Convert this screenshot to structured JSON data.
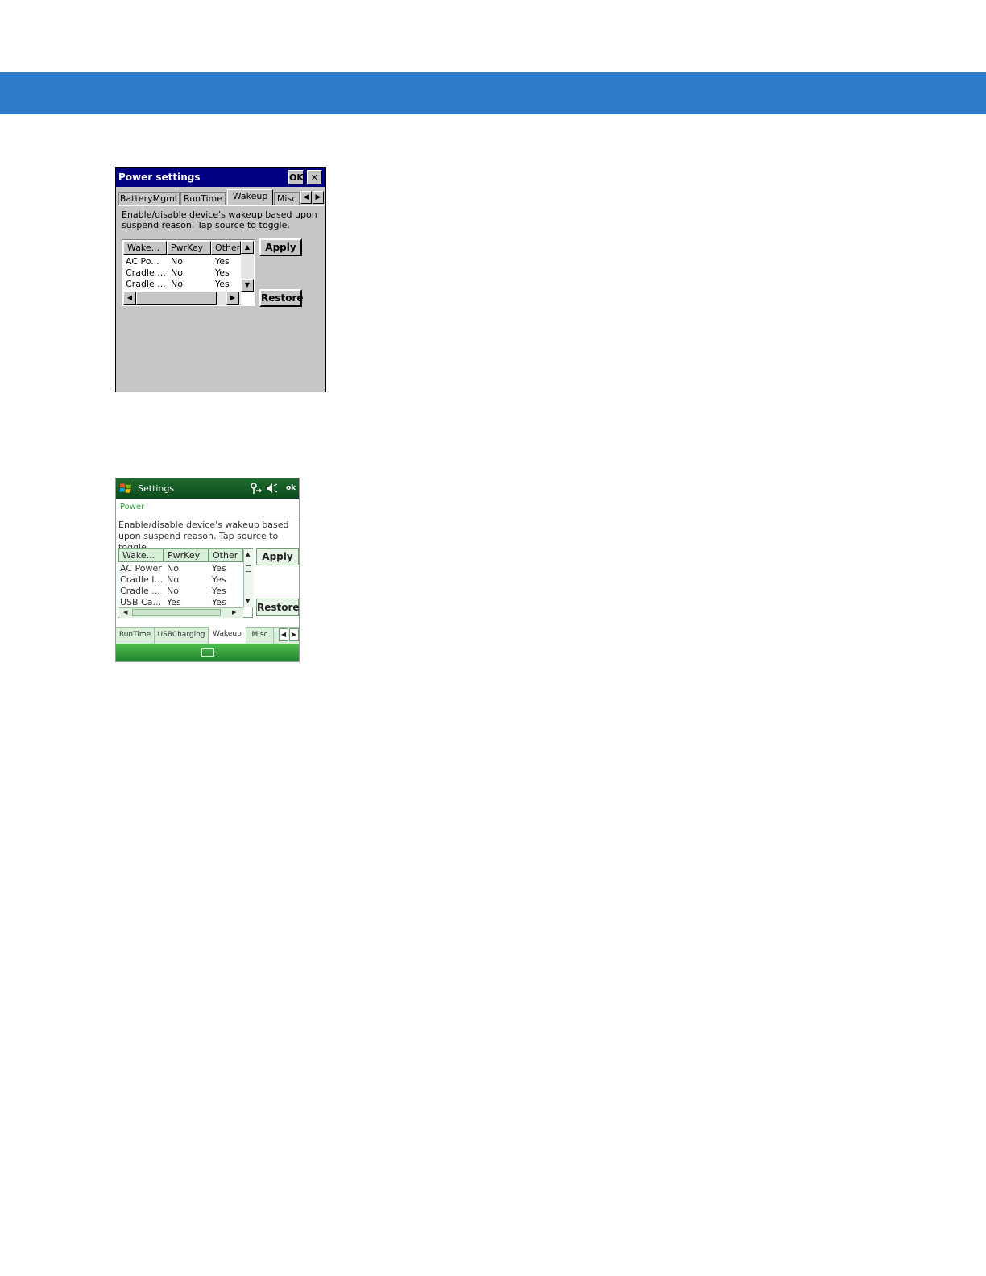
{
  "ce": {
    "title": "Power settings",
    "ok_label": "OK",
    "close_glyph": "✕",
    "tabs": [
      "BatteryMgmt",
      "RunTime",
      "Wakeup",
      "Misc"
    ],
    "active_tab": "Wakeup",
    "tab_arrow_left": "◀",
    "tab_arrow_right": "▶",
    "description": "Enable/disable device's wakeup based upon suspend reason. Tap source to toggle.",
    "columns": [
      "Wake...",
      "PwrKey",
      "Other"
    ],
    "rows": [
      [
        "AC Po...",
        "No",
        "Yes"
      ],
      [
        "Cradle ...",
        "No",
        "Yes"
      ],
      [
        "Cradle ...",
        "No",
        "Yes"
      ]
    ],
    "scroll_up": "▲",
    "scroll_down": "▼",
    "scroll_left": "◀",
    "scroll_right": "▶",
    "apply_label": "Apply",
    "restore_label": "Restore"
  },
  "wm": {
    "title": "Settings",
    "ok_label": "ok",
    "section": "Power",
    "description": "Enable/disable device's wakeup based upon suspend reason. Tap source to toggle.",
    "columns": [
      "Wake...",
      "PwrKey",
      "Other"
    ],
    "rows": [
      [
        "AC Power",
        "No",
        "Yes"
      ],
      [
        "Cradle I...",
        "No",
        "Yes"
      ],
      [
        "Cradle ...",
        "No",
        "Yes"
      ],
      [
        "USB Ca...",
        "Yes",
        "Yes"
      ]
    ],
    "scroll_up": "▲",
    "scroll_down": "▼",
    "scroll_left": "◀",
    "scroll_right": "▶",
    "apply_label": "Apply",
    "restore_label": "Restore",
    "tabs": [
      "RunTime",
      "USBCharging",
      "Wakeup",
      "Misc"
    ],
    "active_tab": "Wakeup",
    "tab_arrow_left": "◀",
    "tab_arrow_right": "▶",
    "status_icons": [
      "connectivity-icon",
      "speaker-muted-icon"
    ]
  },
  "colors": {
    "page_band": "#2e7bc8",
    "ce_titlebar": "#000080",
    "wm_titlebar": "#1c6b2e",
    "wm_accent": "#2fa53c"
  }
}
